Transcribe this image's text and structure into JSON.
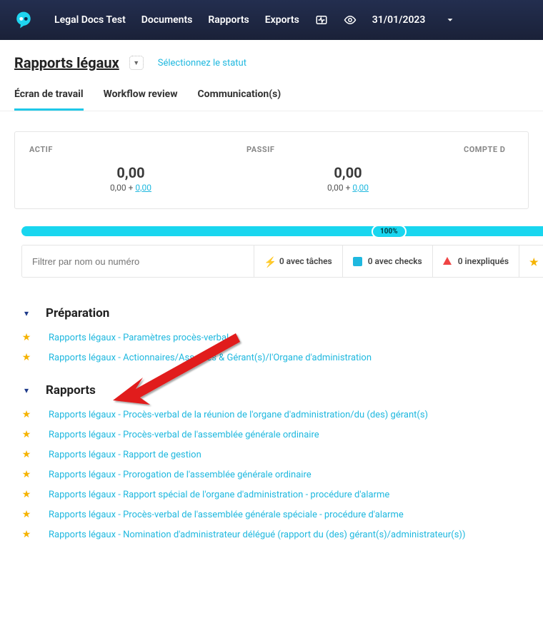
{
  "nav": {
    "brand": "Legal Docs Test",
    "items": [
      "Documents",
      "Rapports",
      "Exports"
    ],
    "date": "31/01/2023"
  },
  "header": {
    "title": "Rapports légaux",
    "status_select": "Sélectionnez le statut"
  },
  "tabs": [
    "Écran de travail",
    "Workflow review",
    "Communication(s)"
  ],
  "summary": {
    "cols": [
      {
        "label": "ACTIF",
        "value": "0,00",
        "sub_a": "0,00 + ",
        "sub_b": "0,00"
      },
      {
        "label": "PASSIF",
        "value": "0,00",
        "sub_a": "0,00 + ",
        "sub_b": "0,00"
      },
      {
        "label": "COMPTE D"
      }
    ]
  },
  "progress": {
    "pct": "100%"
  },
  "filter": {
    "placeholder": "Filtrer par nom ou numéro",
    "chips": {
      "tasks": "0 avec tâches",
      "checks": "0 avec checks",
      "unexpl": "0 inexpliqués"
    }
  },
  "sections": [
    {
      "title": "Préparation",
      "items": [
        "Rapports légaux - Paramètres procès-verbal",
        "Rapports légaux - Actionnaires/Associés & Gérant(s)/l'Organe d'administration"
      ]
    },
    {
      "title": "Rapports",
      "items": [
        "Rapports légaux - Procès-verbal de la réunion de l'organe d'administration/du (des) gérant(s)",
        "Rapports légaux - Procès-verbal de l'assemblée générale ordinaire",
        "Rapports légaux - Rapport de gestion",
        "Rapports légaux - Prorogation de l'assemblée générale ordinaire",
        "Rapports légaux - Rapport spécial de l'organe d'administration - procédure d'alarme",
        "Rapports légaux - Procès-verbal de l'assemblée générale spéciale - procédure d'alarme",
        "Rapports légaux - Nomination d'administrateur délégué (rapport du (des) gérant(s)/administrateur(s))"
      ]
    }
  ]
}
